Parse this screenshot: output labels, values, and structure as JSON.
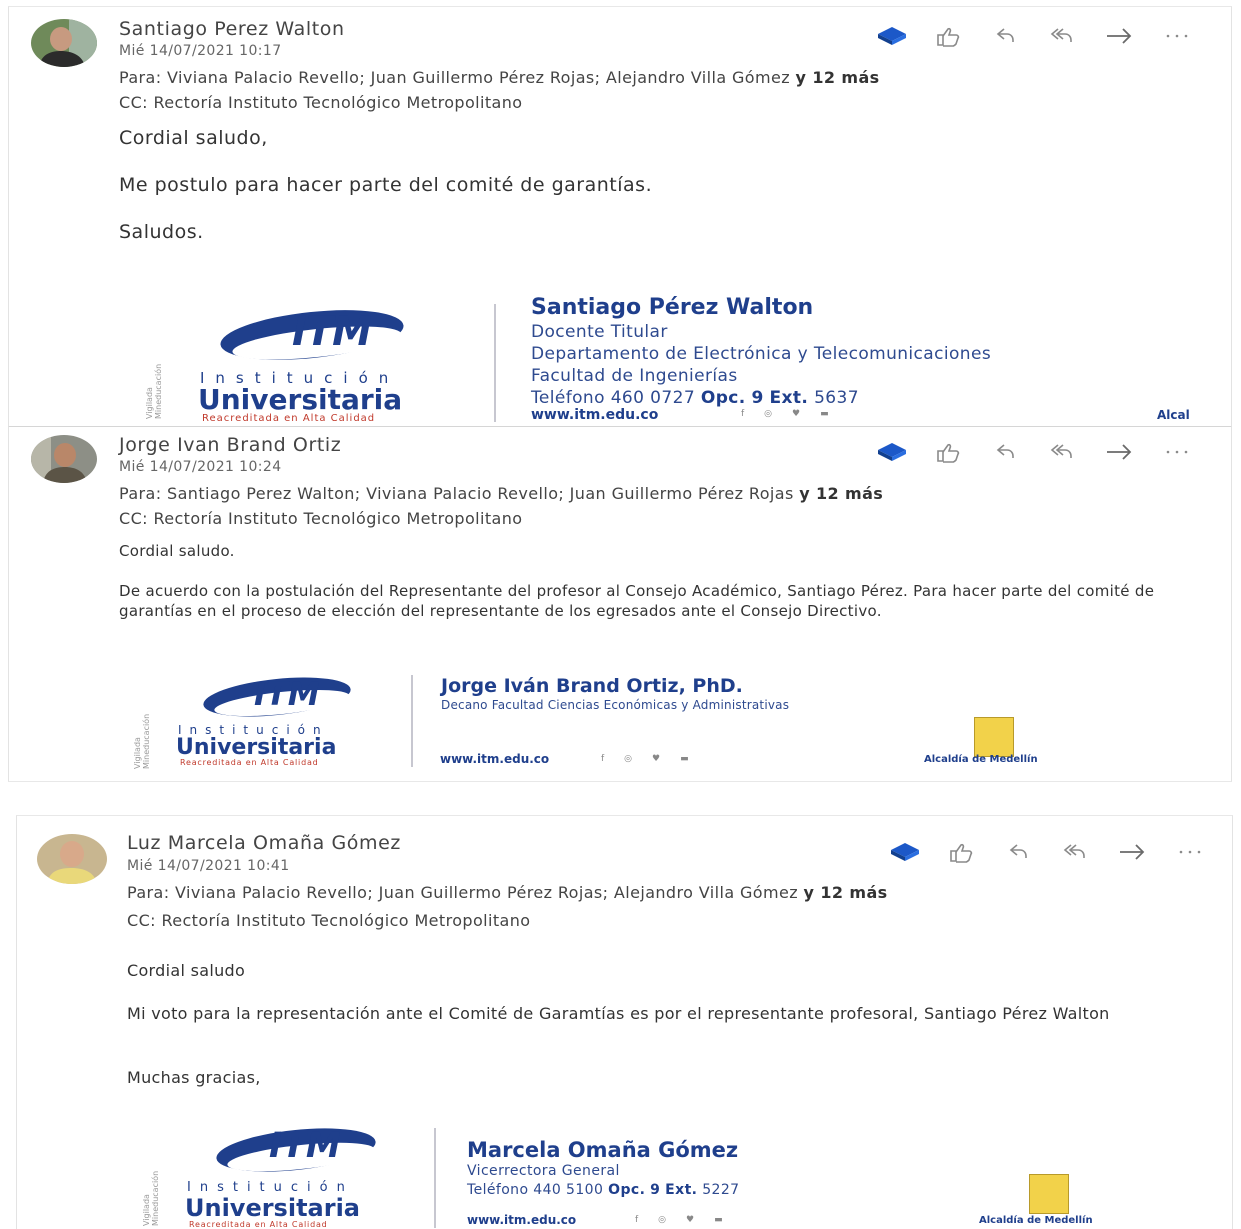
{
  "colors": {
    "accent_blue": "#1f3f8c",
    "label_text": "#444444",
    "diamond": "#1c58c8"
  },
  "action_icons": [
    "category-icon",
    "like-icon",
    "reply-icon",
    "reply-all-icon",
    "forward-icon",
    "more-icon"
  ],
  "logo": {
    "mark": "ITM",
    "institucion": "Institución",
    "universitaria": "Universitaria",
    "acreditada": "Reacreditada en Alta Calidad",
    "vertical_text": "Vigilada Mineducación"
  },
  "emails": [
    {
      "sender": "Santiago Perez Walton",
      "date": "Mié 14/07/2021 10:17",
      "to_label": "Para:",
      "to_recipients": "Viviana Palacio Revello; Juan Guillermo Pérez Rojas; Alejandro Villa Gómez",
      "to_more": "y 12 más",
      "cc_label": "CC:",
      "cc_recipients": "Rectoría Instituto Tecnológico Metropolitano",
      "body": [
        "Cordial saludo,",
        "Me postulo para hacer parte del comité de garantías.",
        "Saludos."
      ],
      "signature": {
        "name": "Santiago Pérez Walton",
        "title": "Docente Titular",
        "dept": "Departamento de Electrónica y Telecomunicaciones",
        "faculty": "Facultad de Ingenierías",
        "phone_label": "Teléfono",
        "phone_number": "460 0727",
        "opc_label": "Opc.",
        "opc_value": "9",
        "ext_label": "Ext.",
        "ext_value": "5637",
        "web": "www.itm.edu.co",
        "alcaldia": "Alcal"
      }
    },
    {
      "sender": "Jorge Ivan Brand Ortiz",
      "date": "Mié 14/07/2021 10:24",
      "to_label": "Para:",
      "to_recipients": "Santiago Perez Walton; Viviana Palacio Revello; Juan Guillermo Pérez Rojas",
      "to_more": "y 12 más",
      "cc_label": "CC:",
      "cc_recipients": "Rectoría Instituto Tecnológico Metropolitano",
      "body": [
        "Cordial saludo.",
        "De acuerdo con la postulación del Representante del profesor al Consejo Académico, Santiago Pérez. Para hacer parte del comité de garantías en el proceso de elección del representante de los egresados ante el Consejo Directivo."
      ],
      "signature": {
        "name": "Jorge Iván Brand Ortiz, PhD.",
        "title": "Decano Facultad Ciencias Económicas y Administrativas",
        "web": "www.itm.edu.co",
        "alcaldia": "Alcaldía de Medellín"
      }
    },
    {
      "sender": "Luz Marcela Omaña Gómez",
      "date": "Mié 14/07/2021 10:41",
      "to_label": "Para:",
      "to_recipients": "Viviana Palacio Revello; Juan Guillermo Pérez Rojas; Alejandro Villa Gómez",
      "to_more": "y 12 más",
      "cc_label": "CC:",
      "cc_recipients": "Rectoría Instituto Tecnológico Metropolitano",
      "body": [
        "Cordial saludo",
        "Mi voto para la representación ante el Comité de Garamtías es por el representante profesoral, Santiago Pérez Walton",
        "Muchas gracias,"
      ],
      "signature": {
        "name": "Marcela Omaña Gómez",
        "title": "Vicerrectora General",
        "phone_label": "Teléfono",
        "phone_number": "440 5100",
        "opc_label": "Opc.",
        "opc_value": "9",
        "ext_label": "Ext.",
        "ext_value": "5227",
        "web": "www.itm.edu.co",
        "alcaldia": "Alcaldía de Medellín"
      }
    }
  ]
}
